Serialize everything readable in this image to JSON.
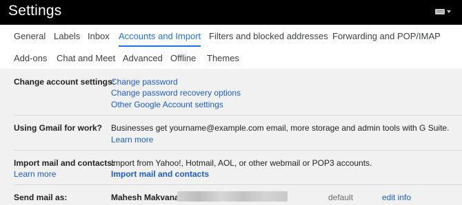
{
  "header": {
    "title": "Settings",
    "keyboard_icon": "keyboard-icon"
  },
  "tabs": [
    {
      "label": "General",
      "active": false
    },
    {
      "label": "Labels",
      "active": false
    },
    {
      "label": "Inbox",
      "active": false
    },
    {
      "label": "Accounts and Import",
      "active": true
    },
    {
      "label": "Filters and blocked addresses",
      "active": false
    },
    {
      "label": "Forwarding and POP/IMAP",
      "active": false
    },
    {
      "label": "Add-ons",
      "active": false
    },
    {
      "label": "Chat and Meet",
      "active": false
    },
    {
      "label": "Advanced",
      "active": false
    },
    {
      "label": "Offline",
      "active": false
    },
    {
      "label": "Themes",
      "active": false
    }
  ],
  "sections": {
    "change_account": {
      "label": "Change account settings:",
      "links": [
        "Change password",
        "Change password recovery options",
        "Other Google Account settings"
      ]
    },
    "gmail_work": {
      "label": "Using Gmail for work?",
      "text": "Businesses get yourname@example.com email, more storage and admin tools with G Suite.",
      "link": "Learn more"
    },
    "import": {
      "label": "Import mail and contacts:",
      "learn_more": "Learn more",
      "text": "Import from Yahoo!, Hotmail, AOL, or other webmail or POP3 accounts.",
      "link": "Import mail and contacts"
    },
    "send_mail": {
      "label": "Send mail as:",
      "name": "Mahesh Makvana",
      "status": "default",
      "edit": "edit info"
    }
  },
  "colors": {
    "accent": "#1a73e8",
    "link": "#1a5dc8",
    "topbar": "#000000",
    "background": "#f1f1f1"
  }
}
